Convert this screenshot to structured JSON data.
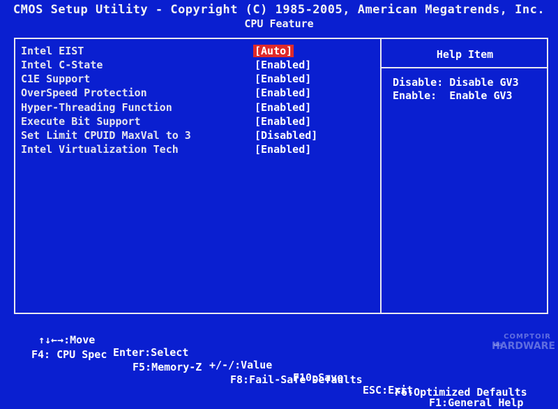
{
  "header": {
    "title": "CMOS Setup Utility - Copyright (C) 1985-2005, American Megatrends, Inc.",
    "subtitle": "CPU Feature"
  },
  "settings": [
    {
      "label": "Intel EIST",
      "value": "[Auto]",
      "selected": true
    },
    {
      "label": "Intel C-State",
      "value": "[Enabled]"
    },
    {
      "label": "C1E Support",
      "value": "[Enabled]"
    },
    {
      "label": "OverSpeed Protection",
      "value": "[Enabled]"
    },
    {
      "label": "Hyper-Threading Function",
      "value": "[Enabled]"
    },
    {
      "label": "Execute Bit Support",
      "value": "[Enabled]"
    },
    {
      "label": "Set Limit CPUID MaxVal to 3",
      "value": "[Disabled]"
    },
    {
      "label": "Intel Virtualization Tech",
      "value": "[Enabled]"
    }
  ],
  "help": {
    "title": "Help Item",
    "lines": [
      "Disable: Disable GV3",
      "Enable:  Enable GV3"
    ]
  },
  "footer": {
    "row1": [
      "↑↓←→:Move",
      "Enter:Select",
      "+/-/:Value",
      "F10:Save",
      "ESC:Exit",
      "F1:General Help"
    ],
    "row2": [
      "F4: CPU Spec",
      "F5:Memory-Z",
      "F8:Fail-Safe Defaults",
      "F6:Optimized Defaults"
    ]
  },
  "watermark": {
    "line1": "COMPTOIR",
    "line0": "du",
    "line2": "HARDWARE"
  },
  "colors": {
    "background": "#0a1fd0",
    "selected": "#e02a2a",
    "text": "#ffffff"
  }
}
